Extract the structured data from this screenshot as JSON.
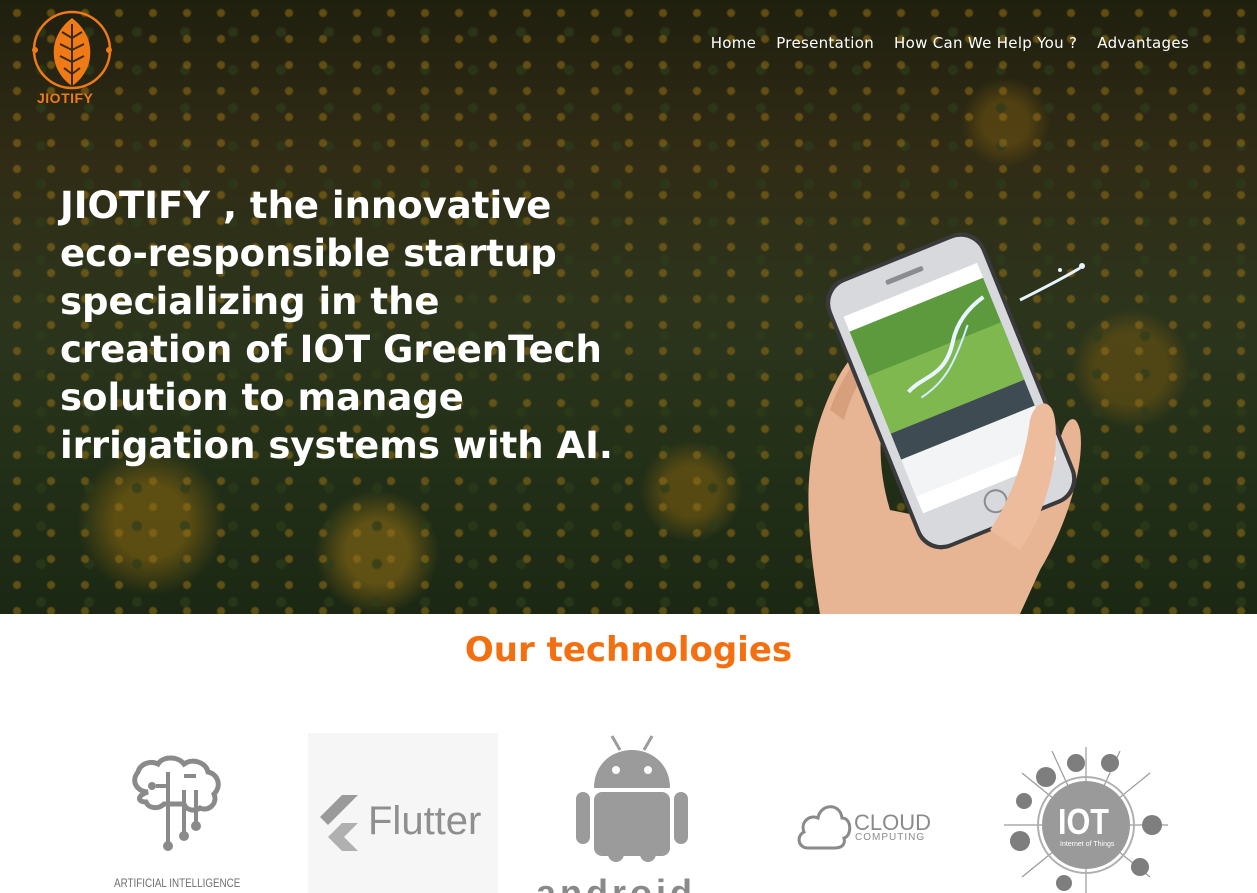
{
  "brand": {
    "name": "JIOTIFY",
    "accent_color": "#f07a16"
  },
  "nav": {
    "items": [
      {
        "label": "Home"
      },
      {
        "label": "Presentation"
      },
      {
        "label": "How Can We Help You ?"
      },
      {
        "label": "Advantages"
      }
    ]
  },
  "hero": {
    "headline": "JIOTIFY , the innovative eco-responsible startup specializing in the creation of IOT GreenTech solution to manage irrigation systems with AI.",
    "image": "hand-holding-phone-over-sunflower-field"
  },
  "technologies": {
    "title": "Our technologies",
    "title_color": "#f46f10",
    "items": [
      {
        "label": "ARTIFICIAL INTELLIGENCE",
        "icon": "brain-circuit-icon"
      },
      {
        "label": "Flutter",
        "icon": "flutter-logo"
      },
      {
        "label": "android",
        "icon": "android-robot-icon"
      },
      {
        "label": "CLOUD",
        "sublabel": "COMPUTING",
        "icon": "cloud-icon"
      },
      {
        "label": "IOT",
        "sublabel": "Internet of Things",
        "icon": "iot-hub-icon"
      }
    ]
  }
}
